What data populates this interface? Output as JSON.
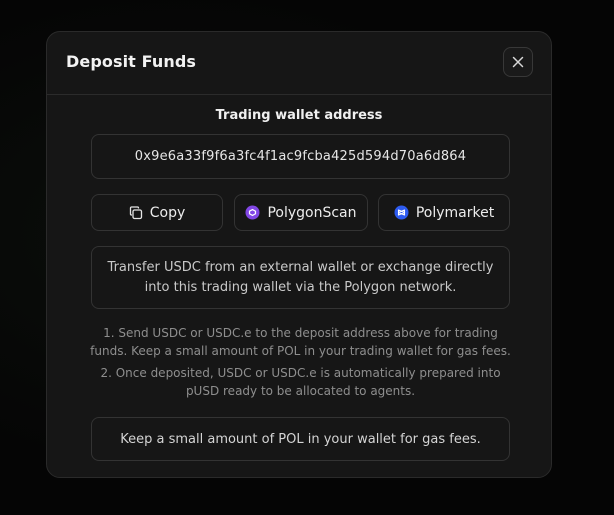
{
  "modal": {
    "title": "Deposit Funds",
    "close_icon": "close-icon"
  },
  "wallet": {
    "label": "Trading wallet address",
    "address": "0x9e6a33f9f6a3fc4f1ac9fcba425d594d70a6d864"
  },
  "actions": {
    "copy": {
      "label": "Copy",
      "icon": "copy-icon"
    },
    "polygonscan": {
      "label": "PolygonScan",
      "icon": "polygonscan-icon",
      "color": "#8247e5"
    },
    "polymarket": {
      "label": "Polymarket",
      "icon": "polymarket-icon",
      "color": "#2d5bf0"
    }
  },
  "info": {
    "text": "Transfer USDC from an external wallet or exchange directly into this trading wallet via the Polygon network."
  },
  "steps": [
    "1. Send USDC or USDC.e to the deposit address above for trading funds. Keep a small amount of POL in your trading wallet for gas fees.",
    "2. Once deposited, USDC or USDC.e is automatically prepared into pUSD ready to be allocated to agents."
  ],
  "gas_note": "Keep a small amount of POL in your wallet for gas fees."
}
